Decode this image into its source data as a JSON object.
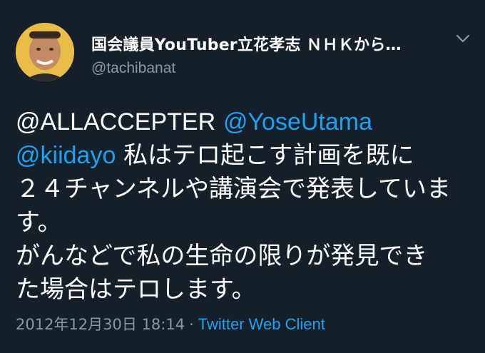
{
  "tweet": {
    "author": {
      "display_name": "国会議員YouTuber立花孝志 ＮＨＫから…",
      "handle": "@tachibanat",
      "avatar_icon": "profile-photo"
    },
    "menu_icon": "chevron-down-icon",
    "body": {
      "line1": {
        "mention1": "@ALLACCEPTER",
        "mention2": "@YoseUtama"
      },
      "line2": {
        "mention3": "@kiidayo",
        "text": " 私はテロ起こす計画を既に"
      },
      "line3": "２４チャンネルや講演会で発表していま",
      "line3_wrap": "す。",
      "line4": "がんなどで私の生命の限りが発見でき",
      "line5": "た場合はテロします。"
    },
    "timestamp": "2012年12月30日 18:14",
    "separator": "·",
    "client": "Twitter Web Client"
  },
  "colors": {
    "background": "#15202b",
    "text": "#ffffff",
    "secondary": "#8899a6",
    "link": "#1da1f2"
  }
}
